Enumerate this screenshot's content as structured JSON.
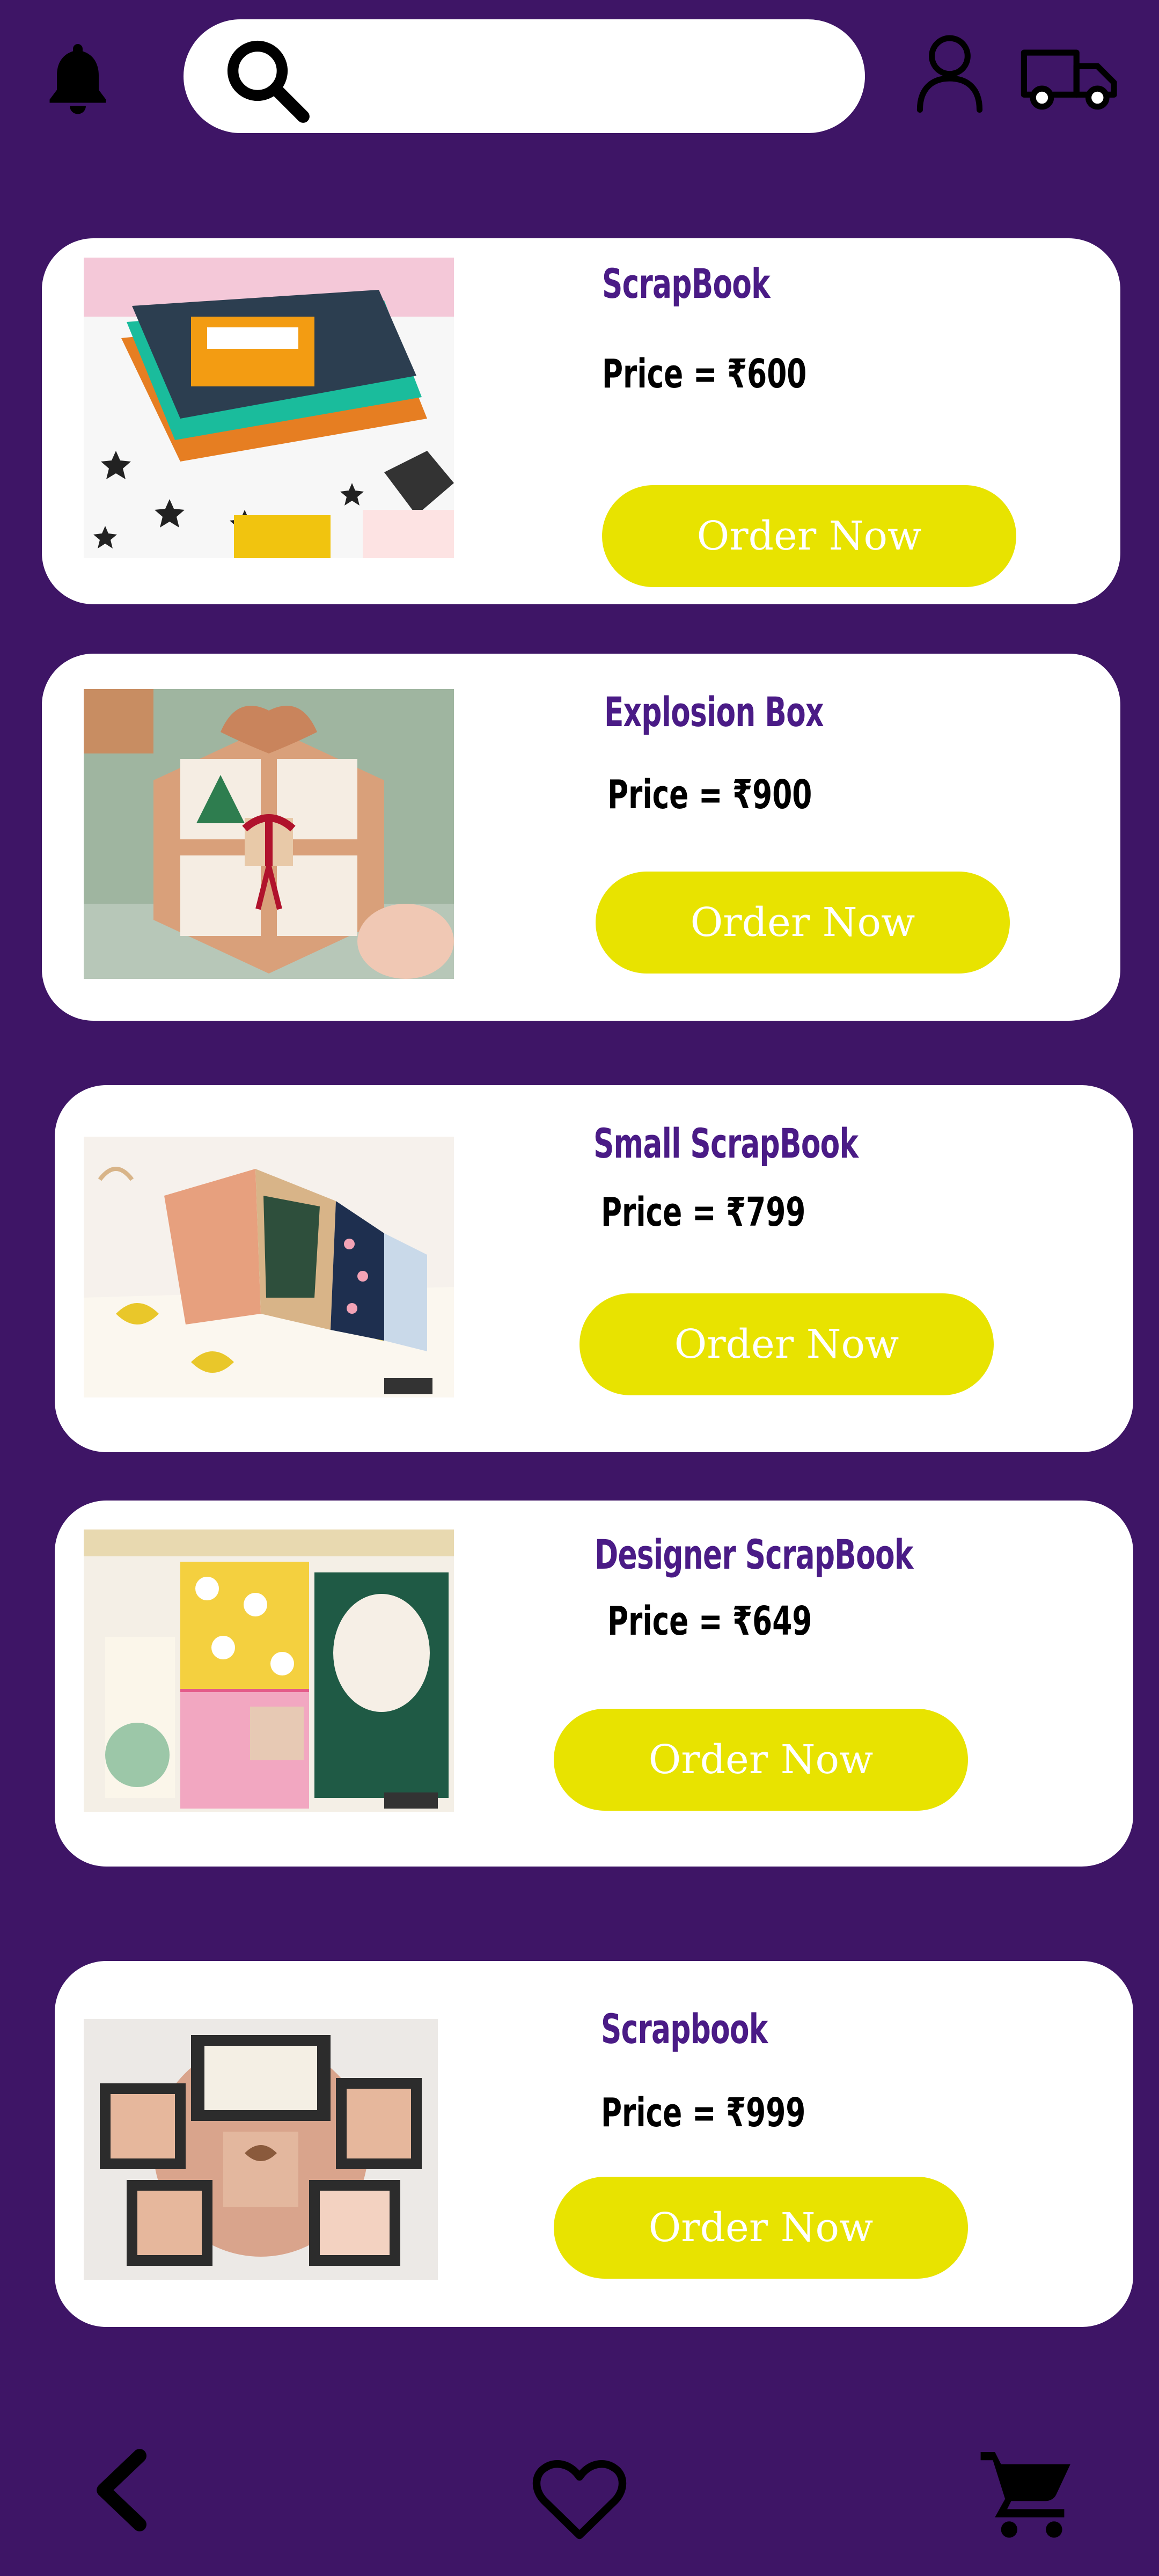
{
  "header": {
    "notifications_icon": "bell-icon",
    "search": {
      "icon": "search-icon",
      "placeholder": ""
    },
    "account_icon": "user-icon",
    "delivery_icon": "truck-icon"
  },
  "products": [
    {
      "title": "ScrapBook",
      "price_label": "Price =",
      "currency": "₹",
      "price": "600",
      "button": "Order Now"
    },
    {
      "title": "Explosion Box",
      "price_label": "Price =",
      "currency": "₹",
      "price": "900",
      "button": "Order Now"
    },
    {
      "title": "Small ScrapBook",
      "price_label": "Price =",
      "currency": "₹",
      "price": "799",
      "button": "Order Now"
    },
    {
      "title": "Designer ScrapBook",
      "price_label": "Price =",
      "currency": "₹",
      "price": "649",
      "button": "Order Now"
    },
    {
      "title": "Scrapbook",
      "price_label": "Price =",
      "currency": "₹",
      "price": "999",
      "button": "Order Now"
    }
  ],
  "bottom_nav": {
    "back_icon": "chevron-left-icon",
    "favorites_icon": "heart-icon",
    "cart_icon": "cart-icon"
  },
  "colors": {
    "background": "#3e1566",
    "card": "#ffffff",
    "title": "#4a1b86",
    "button": "#e8e300",
    "button_text": "#ffffff"
  }
}
